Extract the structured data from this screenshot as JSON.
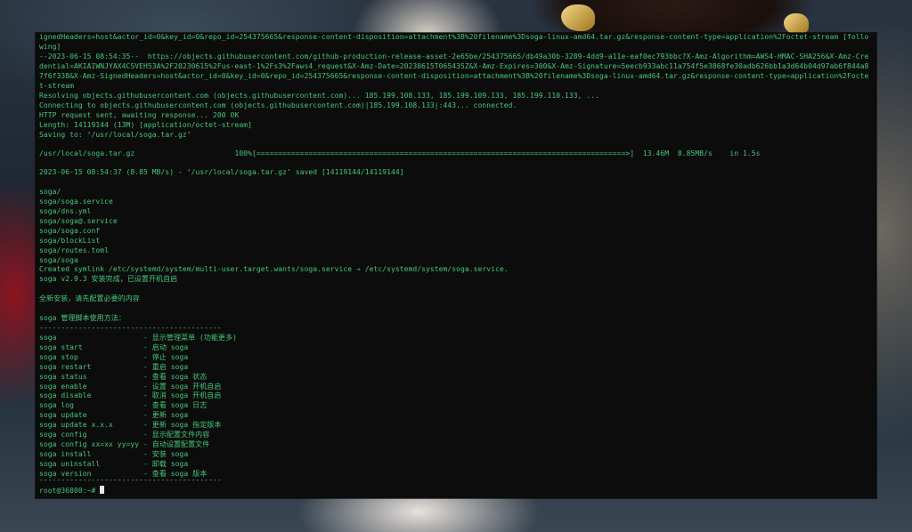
{
  "terminal": {
    "lines": [
      "ignedHeaders=host&actor_id=0&key_id=0&repo_id=254375665&response-content-disposition=attachment%3B%20filename%3Dsoga-linux-amd64.tar.gz&response-content-type=application%2Foctet-stream [follo",
      "wing]",
      "--2023-06-15 08:54:35--  https://objects.githubusercontent.com/github-production-release-asset-2e65be/254375665/db49a30b-3289-4dd9-a11e-eaf0ec793bbc?X-Amz-Algorithm=AWS4-HMAC-SHA256&X-Amz-Cre",
      "dential=AKIAIWNJYAX4CSVEH53A%2F20230615%2Fus-east-1%2Fs3%2Faws4_request&X-Amz-Date=20230615T065435Z&X-Amz-Expires=300&X-Amz-Signature=5eecb933abc11a754f5e3868fe30adb626bb1a3d64b04d97ab6f844a8",
      "7f6f338&X-Amz-SignedHeaders=host&actor_id=0&key_id=0&repo_id=254375665&response-content-disposition=attachment%3B%20filename%3Dsoga-linux-amd64.tar.gz&response-content-type=application%2Focte",
      "t-stream",
      "Resolving objects.githubusercontent.com (objects.githubusercontent.com)... 185.199.108.133, 185.199.109.133, 185.199.110.133, ...",
      "Connecting to objects.githubusercontent.com (objects.githubusercontent.com)|185.199.108.133|:443... connected.",
      "HTTP request sent, awaiting response... 200 OK",
      "Length: 14119144 (13M) [application/octet-stream]",
      "Saving to: ‘/usr/local/soga.tar.gz’",
      "",
      "/usr/local/soga.tar.gz                       100%[=====================================================================================>]  13.46M  8.85MB/s    in 1.5s",
      "",
      "2023-06-15 08:54:37 (8.85 MB/s) - ‘/usr/local/soga.tar.gz’ saved [14119144/14119144]",
      "",
      "soga/",
      "soga/soga.service",
      "soga/dns.yml",
      "soga/soga@.service",
      "soga/soga.conf",
      "soga/blockList",
      "soga/routes.toml",
      "soga/soga",
      "Created symlink /etc/systemd/system/multi-user.target.wants/soga.service → /etc/systemd/system/soga.service.",
      "soga v2.9.3 安装完成，已设置开机自启",
      "",
      "全新安装，请先配置必要的内容",
      "",
      "soga 管理脚本使用方法：",
      "------------------------------------------",
      "soga                    - 显示管理菜单 (功能更多)",
      "soga start              - 启动 soga",
      "soga stop               - 停止 soga",
      "soga restart            - 重启 soga",
      "soga status             - 查看 soga 状态",
      "soga enable             - 设置 soga 开机自启",
      "soga disable            - 取消 soga 开机自启",
      "soga log                - 查看 soga 日志",
      "soga update             - 更新 soga",
      "soga update x.x.x       - 更新 soga 指定版本",
      "soga config             - 显示配置文件内容",
      "soga config xx=xx yy=yy - 自动设置配置文件",
      "soga install            - 安装 soga",
      "soga uninstall          - 卸载 soga",
      "soga version            - 查看 soga 版本",
      "------------------------------------------"
    ],
    "prompt": "root@36800:~# "
  }
}
